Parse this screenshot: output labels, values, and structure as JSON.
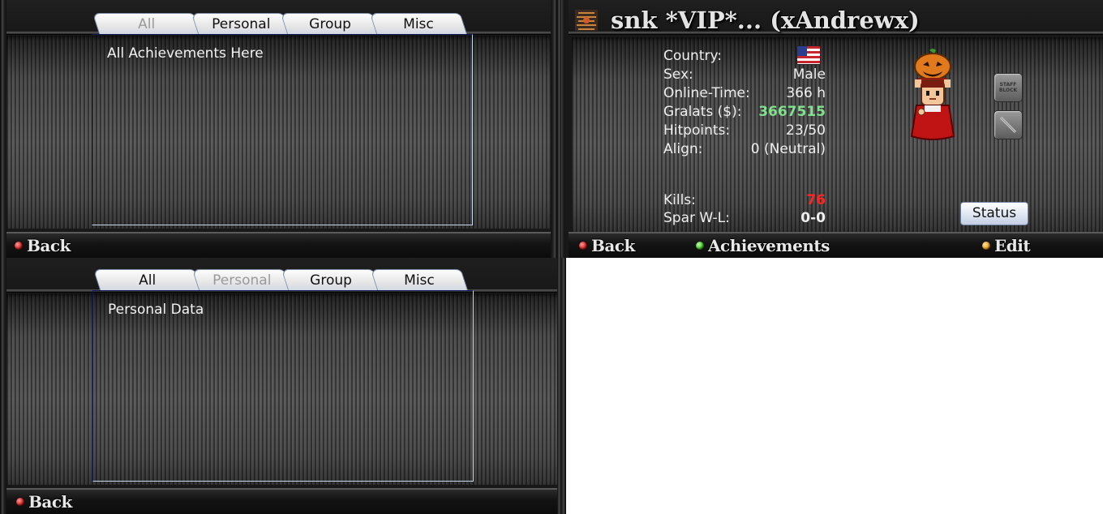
{
  "achievements_panel": {
    "tabs": [
      "All",
      "Personal",
      "Group",
      "Misc"
    ],
    "active_tab": "All",
    "content": "All Achievements Here",
    "back_label": "Back"
  },
  "personal_panel": {
    "tabs": [
      "All",
      "Personal",
      "Group",
      "Misc"
    ],
    "active_tab": "Personal",
    "content": "Personal Data",
    "back_label": "Back"
  },
  "profile": {
    "title": "snk *VIP*... (xAndrewx)",
    "stats": {
      "country_label": "Country:",
      "sex_label": "Sex:",
      "sex": "Male",
      "online_label": "Online-Time:",
      "online": "366 h",
      "gralats_label": "Gralats ($):",
      "gralats": "3667515",
      "hp_label": "Hitpoints:",
      "hp": "23/50",
      "align_label": "Align:",
      "align": "0 (Neutral)",
      "kills_label": "Kills:",
      "kills": "76",
      "spar_label": "Spar W-L:",
      "spar": "0-0"
    },
    "staff_block": "STAFF BLOCK",
    "status_label": "Status",
    "nav": {
      "back": "Back",
      "achievements": "Achievements",
      "edit": "Edit"
    }
  },
  "icons": {
    "country_flag": "us-flag-icon",
    "avatar": "pumpkin-head-player-avatar",
    "sword": "sword-icon"
  }
}
